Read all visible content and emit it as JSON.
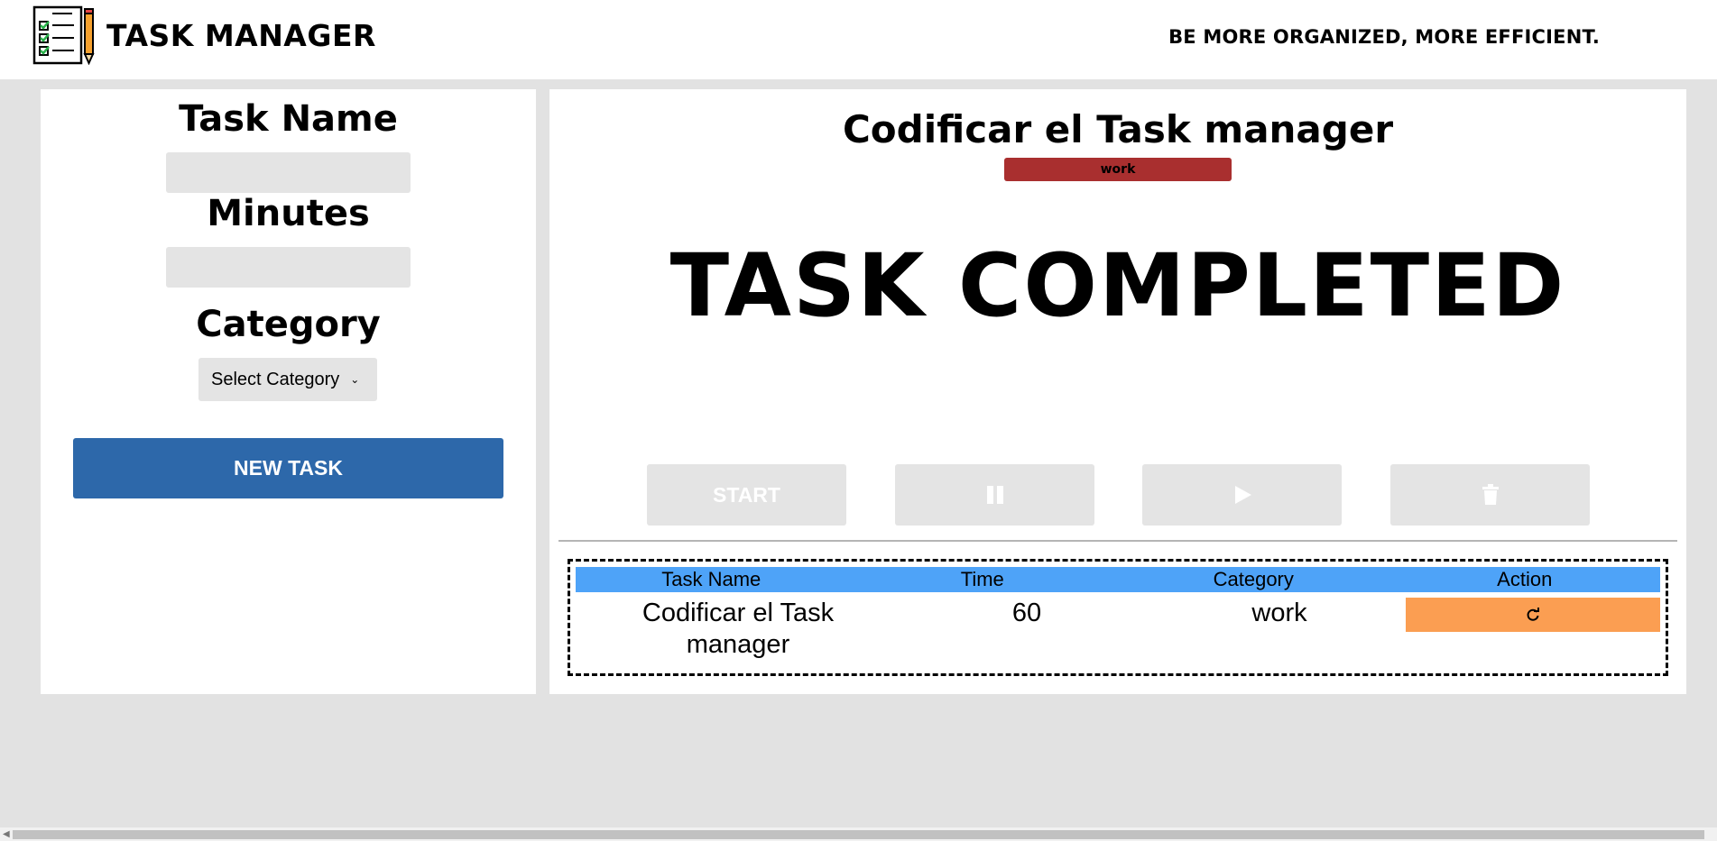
{
  "header": {
    "brand": "TASK MANAGER",
    "tagline": "BE MORE ORGANIZED, MORE EFFICIENT.",
    "logo_icon": "checklist-pencil-icon"
  },
  "form": {
    "task_name_label": "Task Name",
    "task_name_value": "",
    "minutes_label": "Minutes",
    "minutes_value": "",
    "category_label": "Category",
    "category_select": "Select Category",
    "new_task_label": "NEW TASK"
  },
  "current_task": {
    "title": "Codificar el Task manager",
    "category": "work",
    "category_color": "#a92f2f",
    "status": "TASK COMPLETED"
  },
  "controls": {
    "start_label": "START",
    "pause_icon": "pause-icon",
    "play_icon": "play-icon",
    "delete_icon": "trash-icon"
  },
  "table": {
    "headers": [
      "Task Name",
      "Time",
      "Category",
      "Action"
    ],
    "rows": [
      {
        "name": "Codificar el Task manager",
        "time": "60",
        "category": "work",
        "action_icon": "redo-icon"
      }
    ]
  },
  "colors": {
    "primary": "#2d68aa",
    "table_header": "#4ea3f8",
    "action": "#fb9e52",
    "background": "#e2e2e2"
  }
}
